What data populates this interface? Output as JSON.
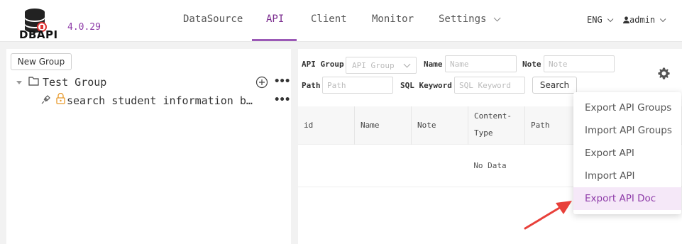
{
  "app": {
    "logo_text": "DBAPI",
    "version": "4.0.29"
  },
  "nav": [
    {
      "label": "DataSource"
    },
    {
      "label": "API"
    },
    {
      "label": "Client"
    },
    {
      "label": "Monitor"
    },
    {
      "label": "Settings"
    }
  ],
  "header": {
    "lang": "ENG",
    "user": "admin"
  },
  "left_panel": {
    "new_group_label": "New Group",
    "tree": {
      "group_name": "Test Group",
      "api_name": "search student information b…"
    }
  },
  "filters": {
    "api_group_label": "API Group",
    "api_group_placeholder": "API Group",
    "name_label": "Name",
    "name_placeholder": "Name",
    "note_label": "Note",
    "note_placeholder": "Note",
    "path_label": "Path",
    "path_placeholder": "Path",
    "sql_label": "SQL Keyword",
    "sql_placeholder": "SQL Keyword",
    "search_label": "Search"
  },
  "table": {
    "columns": [
      "id",
      "Name",
      "Note",
      "Content-",
      "Type",
      "Path"
    ],
    "empty_text": "No Data"
  },
  "menu": {
    "items": [
      "Export API Groups",
      "Import API Groups",
      "Export API",
      "Import API",
      "Export API Doc"
    ]
  },
  "colors": {
    "accent": "#8e3ba8",
    "arrow": "#e8403a",
    "highlight": "#f5e8f8"
  }
}
